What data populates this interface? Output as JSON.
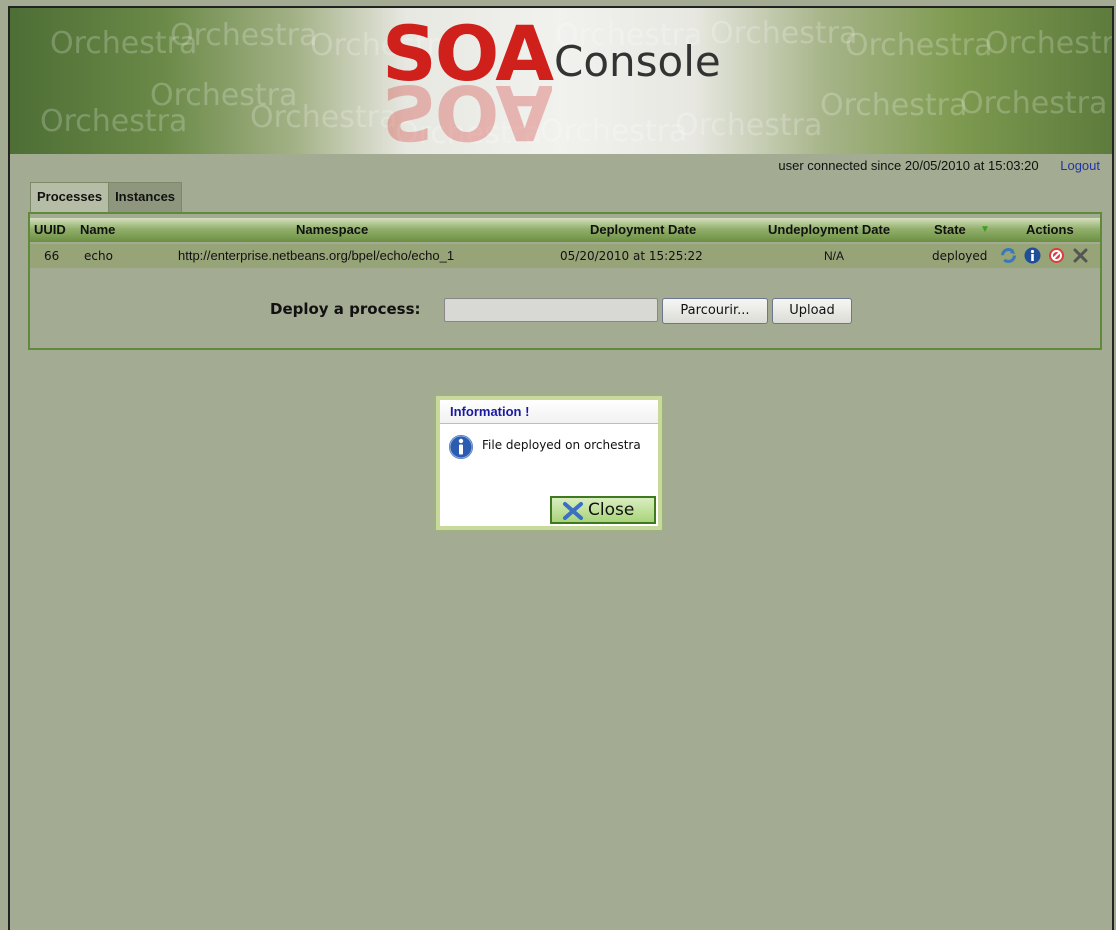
{
  "header": {
    "logo_primary": "SOA",
    "logo_secondary": "Console",
    "watermark": "Orchestra"
  },
  "user_bar": {
    "status": "user connected since 20/05/2010 at 15:03:20",
    "logout_label": "Logout"
  },
  "tabs": [
    {
      "label": "Processes",
      "active": true
    },
    {
      "label": "Instances",
      "active": false
    }
  ],
  "table": {
    "columns": [
      "UUID",
      "Name",
      "Namespace",
      "Deployment Date",
      "Undeployment Date",
      "State",
      "Actions"
    ],
    "sort_indicator": "▼",
    "rows": [
      {
        "uuid": "66",
        "name": "echo",
        "namespace": "http://enterprise.netbeans.org/bpel/echo/echo_1",
        "deployment_date": "05/20/2010 at 15:25:22",
        "undeployment_date": "N/A",
        "state": "deployed",
        "actions": [
          "refresh-icon",
          "info-icon",
          "undeploy-icon",
          "delete-icon"
        ]
      }
    ]
  },
  "deploy": {
    "label": "Deploy a process:",
    "file_value": "",
    "browse_label": "Parcourir...",
    "upload_label": "Upload"
  },
  "dialog": {
    "title": "Information !",
    "message": "File deployed on orchestra",
    "close_label": "Close"
  },
  "colors": {
    "background": "#a3ab92",
    "logo_red": "#d0201c",
    "link_blue": "#2233aa",
    "dialog_title": "#1a1aa0",
    "panel_border": "#5f8a3a"
  }
}
